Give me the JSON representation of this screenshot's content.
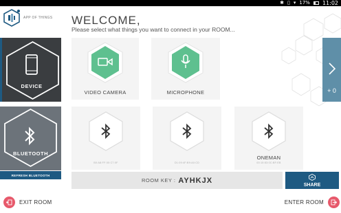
{
  "status_bar": {
    "battery_percent": "17%",
    "time": "11:02"
  },
  "logo": {
    "text": "APP OF THINGS"
  },
  "header": {
    "title": "WELCOME,",
    "subtitle": "Please select what things you want to connect in your ROOM..."
  },
  "categories": [
    {
      "label": "DEVICE",
      "icon": "smartphone-icon"
    },
    {
      "label": "BLUETOOTH",
      "icon": "bluetooth-icon"
    }
  ],
  "refresh_bluetooth_label": "REFRESH BLUETOOTH",
  "device_cards": [
    {
      "label": "VIDEO CAMERA",
      "icon": "video-camera-icon"
    },
    {
      "label": "MICROPHONE",
      "icon": "microphone-icon"
    }
  ],
  "bluetooth_cards": [
    {
      "label": "",
      "sub": "B0:A8:FF:00:C7:0F"
    },
    {
      "label": "",
      "sub": "D1:09:4F:B9:A0:CD"
    },
    {
      "label": "ONEMAN",
      "sub": "00:15:83:0C:BF:EB"
    }
  ],
  "room_key": {
    "label": "ROOM KEY :",
    "value": "AYHKJX"
  },
  "share": {
    "label": "SHARE"
  },
  "side_tab": {
    "count": "+ 0"
  },
  "footer": {
    "exit_label": "EXIT ROOM",
    "enter_label": "ENTER ROOM"
  },
  "colors": {
    "accent_blue": "#1e5a82",
    "green_hex": "#5ec08f",
    "red_button": "#e7596b",
    "side_tab": "#5f8fa8"
  }
}
